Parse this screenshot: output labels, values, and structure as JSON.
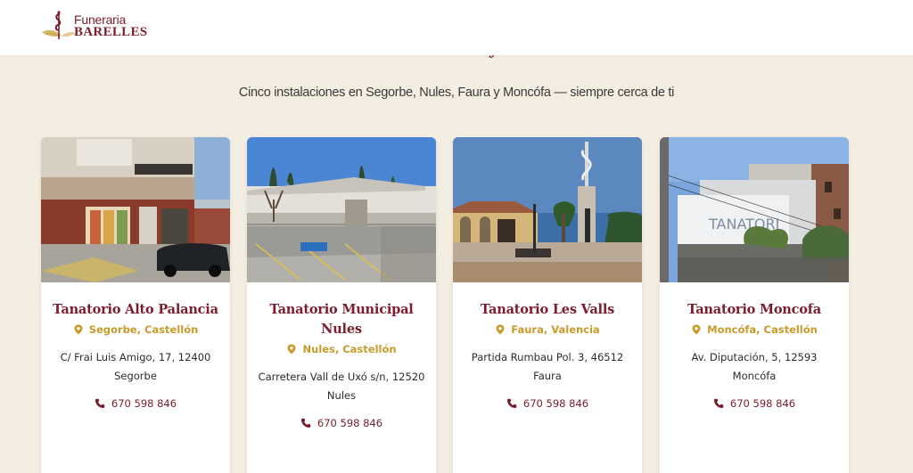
{
  "header": {
    "brand_line1": "Funeraria",
    "brand_line2": "BARELLES"
  },
  "hero": {
    "title_fragment": "y",
    "subtitle": "Cinco instalaciones en Segorbe, Nules, Faura y Moncófa — siempre cerca de ti"
  },
  "cards": [
    {
      "title": "Tanatorio Alto Palancia",
      "location": "Segorbe, Castellón",
      "address": "C/ Frai Luis Amigo, 17, 12400 Segorbe",
      "phone": "670 598 846",
      "photo_icon": "building-photo-icon"
    },
    {
      "title": "Tanatorio Municipal Nules",
      "location": "Nules, Castellón",
      "address": "Carretera Vall de Uxó s/n, 12520 Nules",
      "phone": "670 598 846",
      "photo_icon": "building-photo-icon"
    },
    {
      "title": "Tanatorio Les Valls",
      "location": "Faura, Valencia",
      "address": "Partida Rumbau Pol. 3, 46512 Faura",
      "phone": "670 598 846",
      "photo_icon": "building-photo-icon"
    },
    {
      "title": "Tanatorio Moncofa",
      "location": "Moncófa, Castellón",
      "address": "Av. Diputación, 5, 12593 Moncófa",
      "phone": "670 598 846",
      "photo_icon": "building-photo-icon"
    }
  ],
  "colors": {
    "background": "#f3ede2",
    "brand": "#7b1d2c",
    "accent_gold": "#c89b2a"
  }
}
